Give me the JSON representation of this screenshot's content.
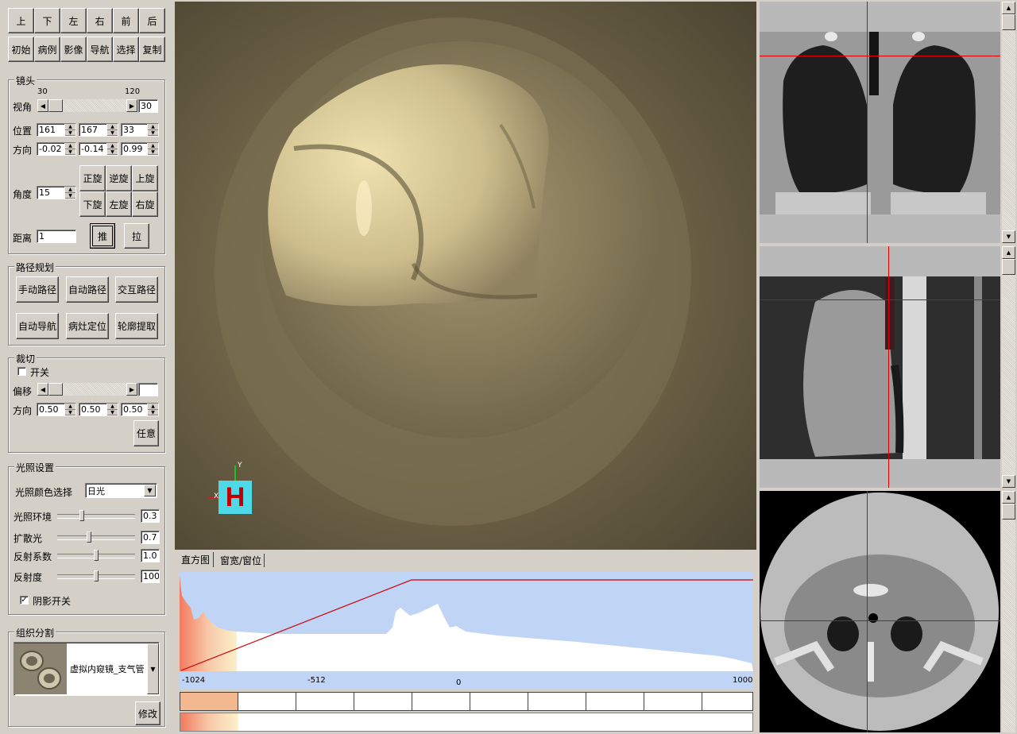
{
  "nav_buttons": [
    "上",
    "下",
    "左",
    "右",
    "前",
    "后"
  ],
  "func_buttons": [
    "初始",
    "病例",
    "影像",
    "导航",
    "选择",
    "复制"
  ],
  "camera": {
    "title": "镜头",
    "fov_label": "视角",
    "fov_min": "30",
    "fov_max": "120",
    "fov_value": "30",
    "position_label": "位置",
    "position": [
      "161",
      "167",
      "33"
    ],
    "direction_label": "方向",
    "direction": [
      "-0.02",
      "-0.14",
      "0.99"
    ],
    "angle_label": "角度",
    "angle_value": "15",
    "rotate_buttons": [
      "正旋",
      "逆旋",
      "上旋",
      "下旋",
      "左旋",
      "右旋"
    ],
    "distance_label": "距离",
    "distance_value": "1",
    "push_label": "推",
    "pull_label": "拉"
  },
  "path": {
    "title": "路径规划",
    "buttons": [
      "手动路径",
      "自动路径",
      "交互路径",
      "自动导航",
      "病灶定位",
      "轮廓提取"
    ]
  },
  "clip": {
    "title": "裁切",
    "toggle_label": "开关",
    "toggle_checked": false,
    "offset_label": "偏移",
    "offset_value": "",
    "direction_label": "方向",
    "direction": [
      "0.50",
      "0.50",
      "0.50"
    ],
    "any_label": "任意"
  },
  "light": {
    "title": "光照设置",
    "color_label": "光照颜色选择",
    "color_value": "日光",
    "ambient_label": "光照环境",
    "ambient_value": "0.3",
    "ambient_level": 0.3,
    "diffuse_label": "扩散光",
    "diffuse_value": "0.7",
    "diffuse_level": 0.4,
    "reflect_coef_label": "反射系数",
    "reflect_coef_value": "1.0",
    "reflect_coef_level": 0.5,
    "reflectivity_label": "反射度",
    "reflectivity_value": "100",
    "reflectivity_level": 0.5,
    "shadow_label": "阴影开关",
    "shadow_checked": true
  },
  "tissue": {
    "title": "组织分割",
    "preset_label": "虚拟内窥镜_支气管",
    "modify_label": "修改"
  },
  "orientation": {
    "x_label": "X",
    "y_label": "Y",
    "marker_label": "H"
  },
  "tabs": [
    "直方图",
    "窗宽/窗位"
  ],
  "histogram": {
    "axis_labels": [
      "-1024",
      "-512",
      "0",
      "1000"
    ],
    "colors": {
      "background": "#c0d4f5",
      "curve": "#cc0000",
      "bins": "#ffffff"
    }
  }
}
